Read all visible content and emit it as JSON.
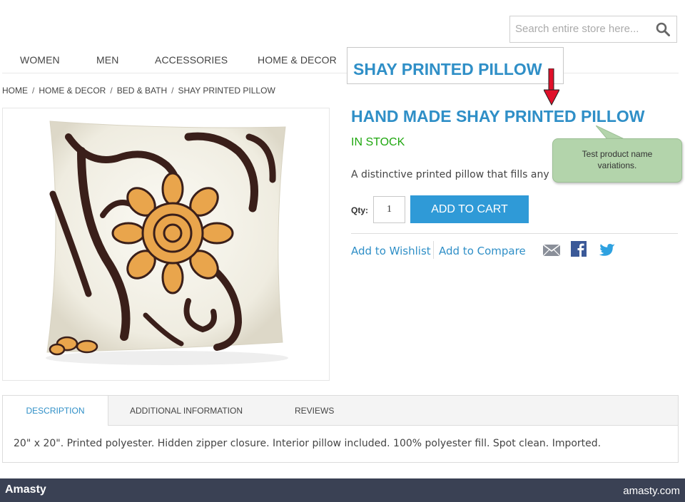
{
  "search": {
    "placeholder": "Search entire store here..."
  },
  "nav": {
    "items": [
      "WOMEN",
      "MEN",
      "ACCESSORIES",
      "HOME & DECOR"
    ]
  },
  "name_variation": "SHAY PRINTED PILLOW",
  "breadcrumb": [
    "HOME",
    "HOME & DECOR",
    "BED & BATH",
    "SHAY PRINTED PILLOW"
  ],
  "product": {
    "name": "HAND MADE SHAY PRINTED PILLOW",
    "stock": "IN STOCK",
    "short_description": "A distinctive printed pillow that fills any ro",
    "qty_label": "Qty:",
    "qty_value": "1",
    "add_to_cart": "ADD TO CART",
    "wishlist": "Add to Wishlist",
    "compare": "Add to Compare"
  },
  "tooltip": "Test product name variations.",
  "tabs": [
    {
      "label": "DESCRIPTION",
      "active": true
    },
    {
      "label": "ADDITIONAL INFORMATION",
      "active": false
    },
    {
      "label": "REVIEWS",
      "active": false
    }
  ],
  "description_text": "20\" x 20\". Printed polyester. Hidden zipper closure. Interior pillow included. 100% polyester fill. Spot clean. Imported.",
  "footer": {
    "brand": "Amasty",
    "site": "amasty.com"
  },
  "colors": {
    "accent": "#2f8fc7",
    "button": "#2f9ad7",
    "stock": "#1fa70f",
    "tooltip": "#b3d4ab",
    "footer": "#3a4154"
  },
  "icons": [
    "search-icon",
    "email-icon",
    "facebook-icon",
    "twitter-icon",
    "red-arrow-icon"
  ]
}
